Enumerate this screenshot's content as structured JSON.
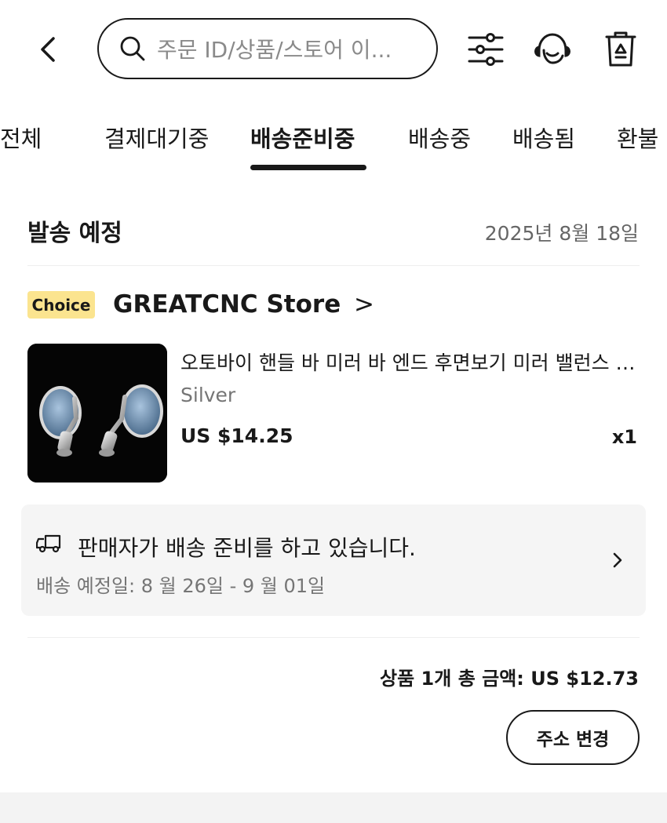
{
  "header": {
    "search_placeholder": "주문 ID/상품/스토어 이...",
    "icons": [
      "back-icon",
      "search-icon",
      "filter-sliders-icon",
      "headset-support-icon",
      "recycle-bin-icon"
    ]
  },
  "tabs": [
    {
      "label": "전체",
      "active": false
    },
    {
      "label": "결제대기중",
      "active": false
    },
    {
      "label": "배송준비중",
      "active": true
    },
    {
      "label": "배송중",
      "active": false
    },
    {
      "label": "배송됨",
      "active": false
    },
    {
      "label": "환불 &",
      "active": false
    }
  ],
  "section": {
    "title": "발송 예정",
    "date": "2025년 8월 18일"
  },
  "store": {
    "badge": "Choice",
    "name": "GREATCNC Store",
    "chevron": ">"
  },
  "product": {
    "title": "오토바이 핸들 바 미러 바 엔드 후면보기 미러 밸런스 슬...",
    "variant": "Silver",
    "price": "US $14.25",
    "quantity": "x1"
  },
  "shipping": {
    "status": "판매자가 배송 준비를 하고 있습니다.",
    "eta": "배송 예정일: 8 월 26일 - 9 월 01일"
  },
  "order": {
    "total": "상품 1개 총 금액: US $12.73",
    "change_address_label": "주소 변경"
  },
  "colors": {
    "text": "#191919",
    "muted": "#757575",
    "choice_badge": "#fbe48f",
    "panel": "#f5f5f5"
  }
}
